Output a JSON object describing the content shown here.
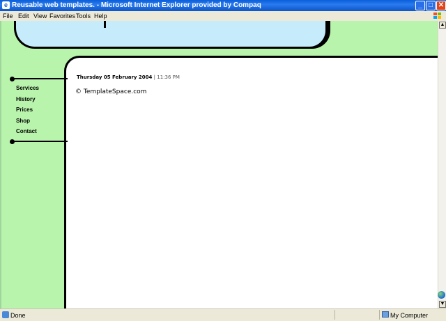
{
  "window": {
    "title": "Reusable web templates. - Microsoft Internet Explorer provided by Compaq",
    "buttons": {
      "minimize": "_",
      "maximize": "□",
      "close": "✕"
    }
  },
  "menu": {
    "items": [
      "File",
      "Edit",
      "View",
      "Favorites",
      "Tools",
      "Help"
    ]
  },
  "page": {
    "nav": [
      "Services",
      "History",
      "Prices",
      "Shop",
      "Contact"
    ],
    "date": "Thursday 05 February 2004",
    "separator": "|",
    "time": "11:36 PM",
    "copyright": "© TemplateSpace.com",
    "colors": {
      "background": "#b8f4ac",
      "cloud": "#c6ecfb",
      "panel": "#ffffff"
    }
  },
  "status": {
    "text": "Done",
    "zone": "My Computer"
  },
  "scrollbar": {
    "up": "▲",
    "down": "▼"
  }
}
